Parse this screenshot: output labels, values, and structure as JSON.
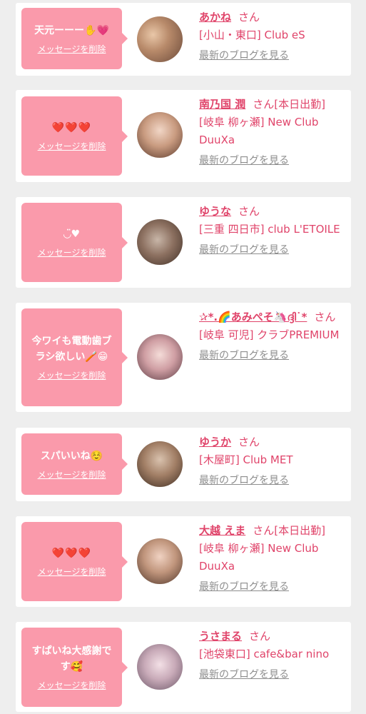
{
  "delete_label": "メッセージを削除",
  "blog_label": "最新のブログを見る",
  "accent_color": "#fa9aab",
  "name_color": "#e0446a",
  "cards": [
    {
      "message": "天元ーーー✋💗",
      "name": "あかね",
      "suffix": "さん",
      "shop": "[小山・東口] Club eS"
    },
    {
      "message": "❤️❤️❤️",
      "name": "南乃国 潤",
      "suffix": "さん[本日出勤]",
      "shop": "[岐阜 柳ヶ瀬] New Club DuuXa"
    },
    {
      "message": "◡̈♥︎",
      "name": "ゆうな",
      "suffix": "さん",
      "shop": "[三重 四日市] club L'ETOILE"
    },
    {
      "message": "今ワイも電動歯ブラシ欲しい🪥😁",
      "name": "✰*.🌈あみぺそ🦄ദ്ദി˙*",
      "suffix": "さん",
      "shop": "[岐阜 可児] クラブPREMIUM"
    },
    {
      "message": "スパいいね☺️",
      "name": "ゆうか",
      "suffix": "さん",
      "shop": "[木屋町] Club MET"
    },
    {
      "message": "❤️❤️❤️",
      "name": "大越 えま",
      "suffix": "さん[本日出勤]",
      "shop": "[岐阜 柳ヶ瀬] New Club DuuXa"
    },
    {
      "message": "すぱいね大感謝です🥰",
      "name": "うさまる",
      "suffix": "さん",
      "shop": "[池袋東口] cafe&bar nino"
    }
  ]
}
